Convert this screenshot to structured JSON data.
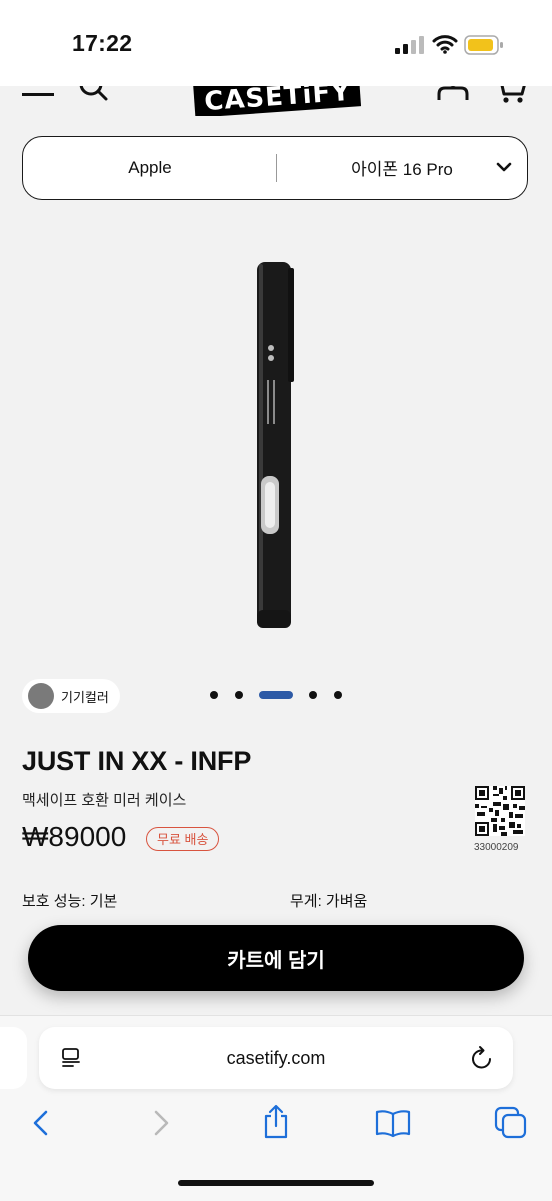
{
  "status_bar": {
    "time": "17:22"
  },
  "site_header": {
    "logo_text": "CASETiFY"
  },
  "device_selector": {
    "brand": "Apple",
    "model": "아이폰 16 Pro"
  },
  "product": {
    "color_chip_label": "기기컬러",
    "title": "JUST IN XX - INFP",
    "subtitle": "맥세이프 호환 미러 케이스",
    "price": "₩89000",
    "shipping_badge": "무료 배송",
    "qr_number": "33000209",
    "spec_protection": "보호 성능: 기본",
    "spec_weight": "무게: 가벼움",
    "carousel": {
      "total": 5,
      "active_index": 2
    }
  },
  "cta": {
    "add_to_cart": "카트에 담기"
  },
  "browser": {
    "url": "casetify.com"
  },
  "colors": {
    "accent_blue": "#2d5aa6",
    "badge_red": "#d8543f",
    "button_black": "#000000",
    "ios_blue": "#1e6fd9"
  }
}
